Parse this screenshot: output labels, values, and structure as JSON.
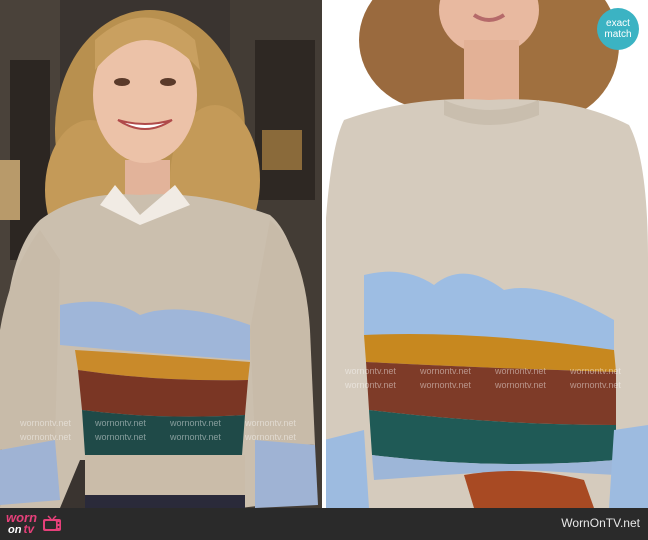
{
  "match_badge": {
    "line1": "exact",
    "line2": "match"
  },
  "footer": {
    "brand": {
      "worn": "worn",
      "on": "on",
      "tv": "tv"
    },
    "site_name": "WornOnTV.net"
  },
  "watermark_text": "wornontv.net",
  "colors": {
    "badge": "#3bb3c3",
    "brand_pink": "#e6407a",
    "footer_bg": "#2a2a2a"
  }
}
